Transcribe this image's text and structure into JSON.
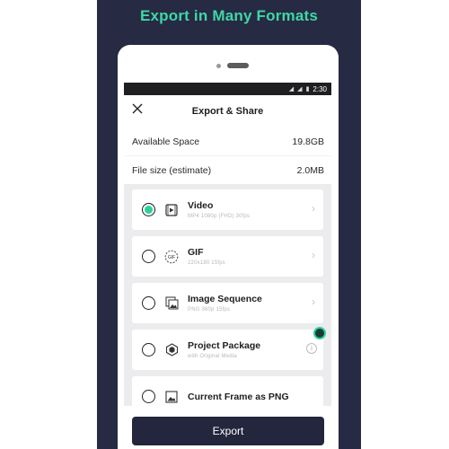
{
  "banner": {
    "headline": "Export in Many Formats"
  },
  "status_bar": {
    "time": "2:30"
  },
  "dialog": {
    "title": "Export & Share",
    "close_icon": "close-icon",
    "available_space": {
      "label": "Available Space",
      "value": "19.8GB"
    },
    "file_size": {
      "label": "File size (estimate)",
      "value": "2.0MB"
    }
  },
  "formats": [
    {
      "name": "Video",
      "sub": "MP4 1080p (FHD) 30fps",
      "selected": true,
      "icon": "video-file-icon",
      "trailing": "chevron-right-icon"
    },
    {
      "name": "GIF",
      "sub": "220x180 15fps",
      "selected": false,
      "icon": "gif-icon",
      "trailing": "chevron-right-icon"
    },
    {
      "name": "Image Sequence",
      "sub": "PNG 360p 15fps",
      "selected": false,
      "icon": "image-stack-icon",
      "trailing": "chevron-right-icon"
    },
    {
      "name": "Project Package",
      "sub": "with Original Media",
      "selected": false,
      "icon": "package-icon",
      "trailing": "info-icon"
    },
    {
      "name": "Current Frame as PNG",
      "sub": "",
      "selected": false,
      "icon": "image-icon",
      "trailing": ""
    }
  ],
  "export_button": {
    "label": "Export"
  },
  "colors": {
    "navy": "#262a43",
    "accent": "#2bd19c",
    "headline": "#3fd6a8"
  }
}
